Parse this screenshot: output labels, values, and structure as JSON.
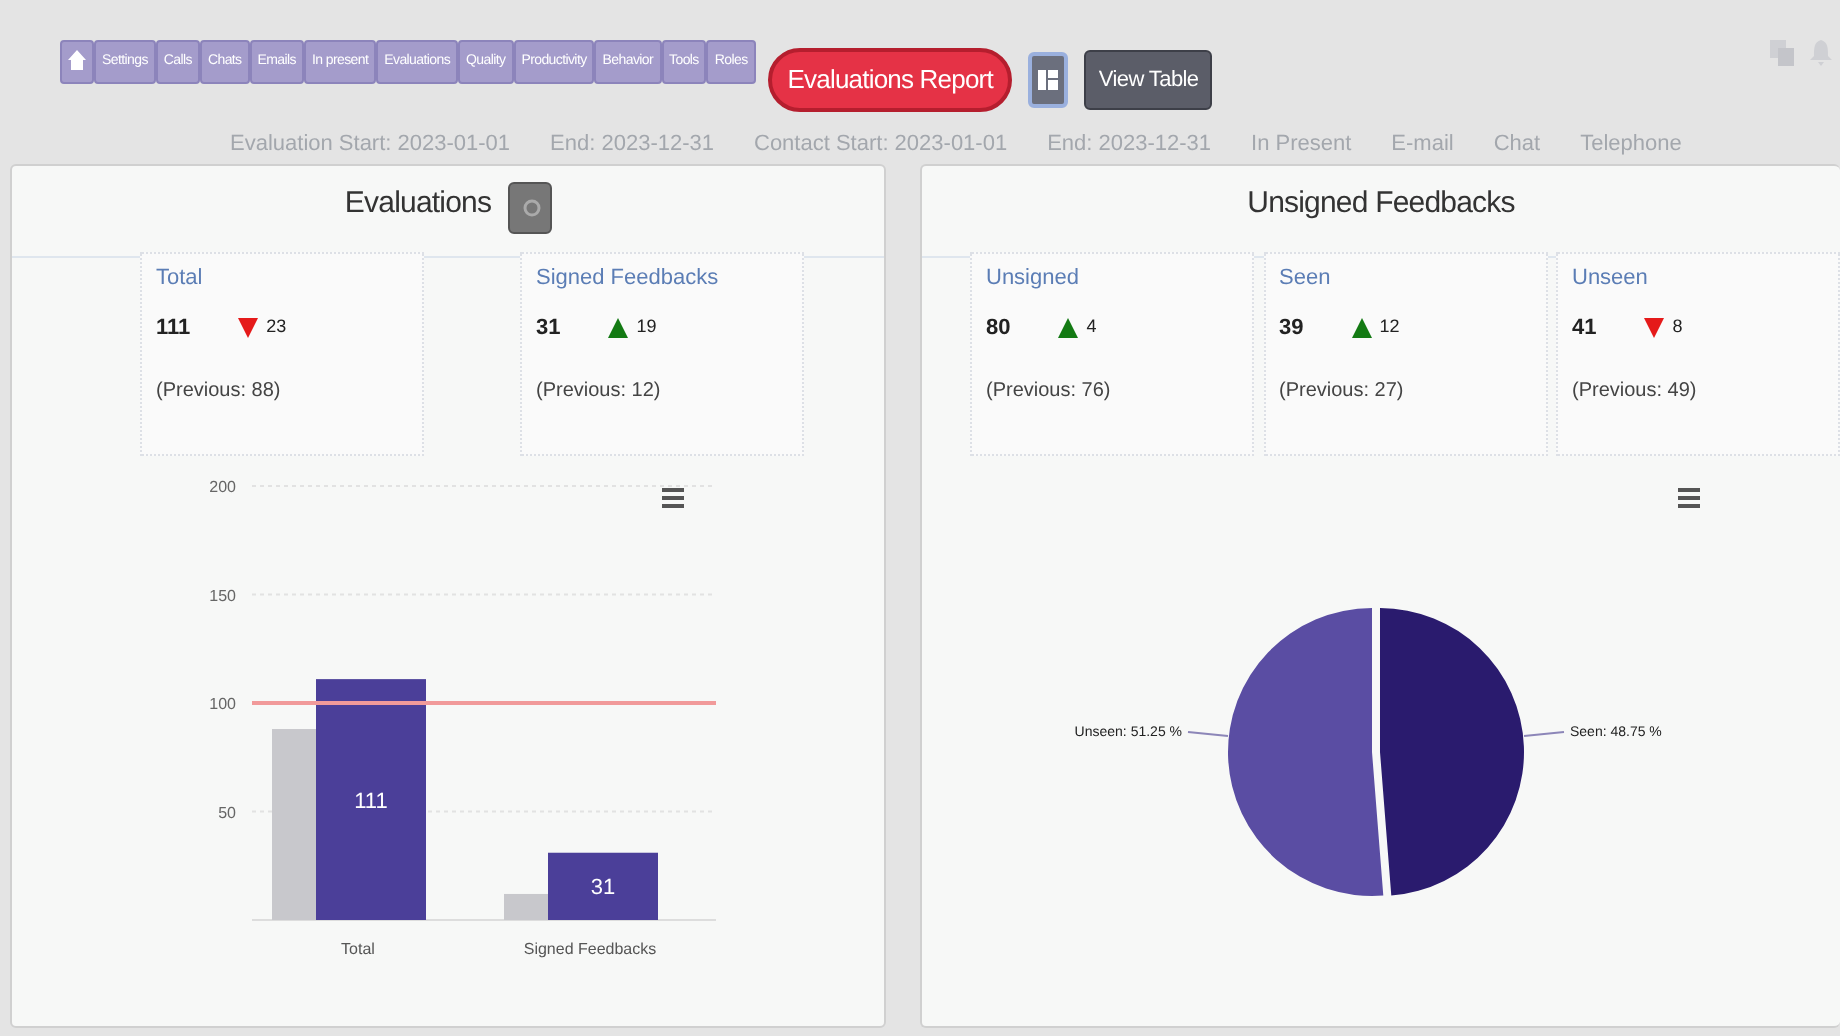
{
  "nav_tabs": [
    {
      "kind": "home"
    },
    {
      "kind": "text",
      "label": "Settings"
    },
    {
      "kind": "text",
      "label": "Calls"
    },
    {
      "kind": "text",
      "label": "Chats"
    },
    {
      "kind": "text",
      "label": "Emails"
    },
    {
      "kind": "text",
      "label": "In present"
    },
    {
      "kind": "text",
      "label": "Evaluations"
    },
    {
      "kind": "text",
      "label": "Quality"
    },
    {
      "kind": "text",
      "label": "Productivity"
    },
    {
      "kind": "text",
      "label": "Behavior"
    },
    {
      "kind": "text",
      "label": "Tools"
    },
    {
      "kind": "text",
      "label": "Roles"
    }
  ],
  "report_button": "Evaluations Report",
  "view_table_button": "View Table",
  "filters": [
    "Evaluation Start: 2023-01-01",
    "End: 2023-12-31",
    "Contact Start: 2023-01-01",
    "End: 2023-12-31",
    "In Present",
    "E-mail",
    "Chat",
    "Telephone"
  ],
  "panels": [
    {
      "title": "Evaluations",
      "has_icon_button": true,
      "stats": [
        {
          "title": "Total",
          "value": "111",
          "increase": false,
          "delta": "23",
          "previous": "(Previous: 88)"
        },
        {
          "title": "Signed Feedbacks",
          "value": "31",
          "increase": true,
          "delta": "19",
          "previous": "(Previous: 12)"
        }
      ],
      "chart_data": {
        "type": "bar",
        "categories": [
          "Total",
          "Signed Feedbacks"
        ],
        "series": [
          {
            "color": "#c8c8cc",
            "values": [
              88,
              12
            ]
          },
          {
            "color": "#4b3f99",
            "values": [
              111,
              31
            ]
          }
        ],
        "ylim": [
          0,
          200
        ],
        "yticks": [
          50,
          100,
          150,
          200
        ],
        "value_labels": [
          "111",
          "31"
        ],
        "ref_lines": [
          {
            "axis": "y",
            "value": 100,
            "color": "#f19a9a"
          }
        ]
      }
    },
    {
      "title": "Unsigned Feedbacks",
      "has_icon_button": false,
      "stats": [
        {
          "title": "Unsigned",
          "value": "80",
          "increase": true,
          "delta": "4",
          "previous": "(Previous: 76)"
        },
        {
          "title": "Seen",
          "value": "39",
          "increase": true,
          "delta": "12",
          "previous": "(Previous: 27)"
        },
        {
          "title": "Unseen",
          "value": "41",
          "increase": false,
          "delta": "8",
          "previous": "(Previous: 49)"
        }
      ],
      "chart_data": {
        "type": "pie",
        "values": [
          48.75,
          51.25
        ],
        "colors": [
          "#2a1b6e",
          "#5a4da3"
        ],
        "value_labels": [
          "Seen: 48.75 %",
          "Unseen: 51.25 %"
        ]
      }
    }
  ]
}
